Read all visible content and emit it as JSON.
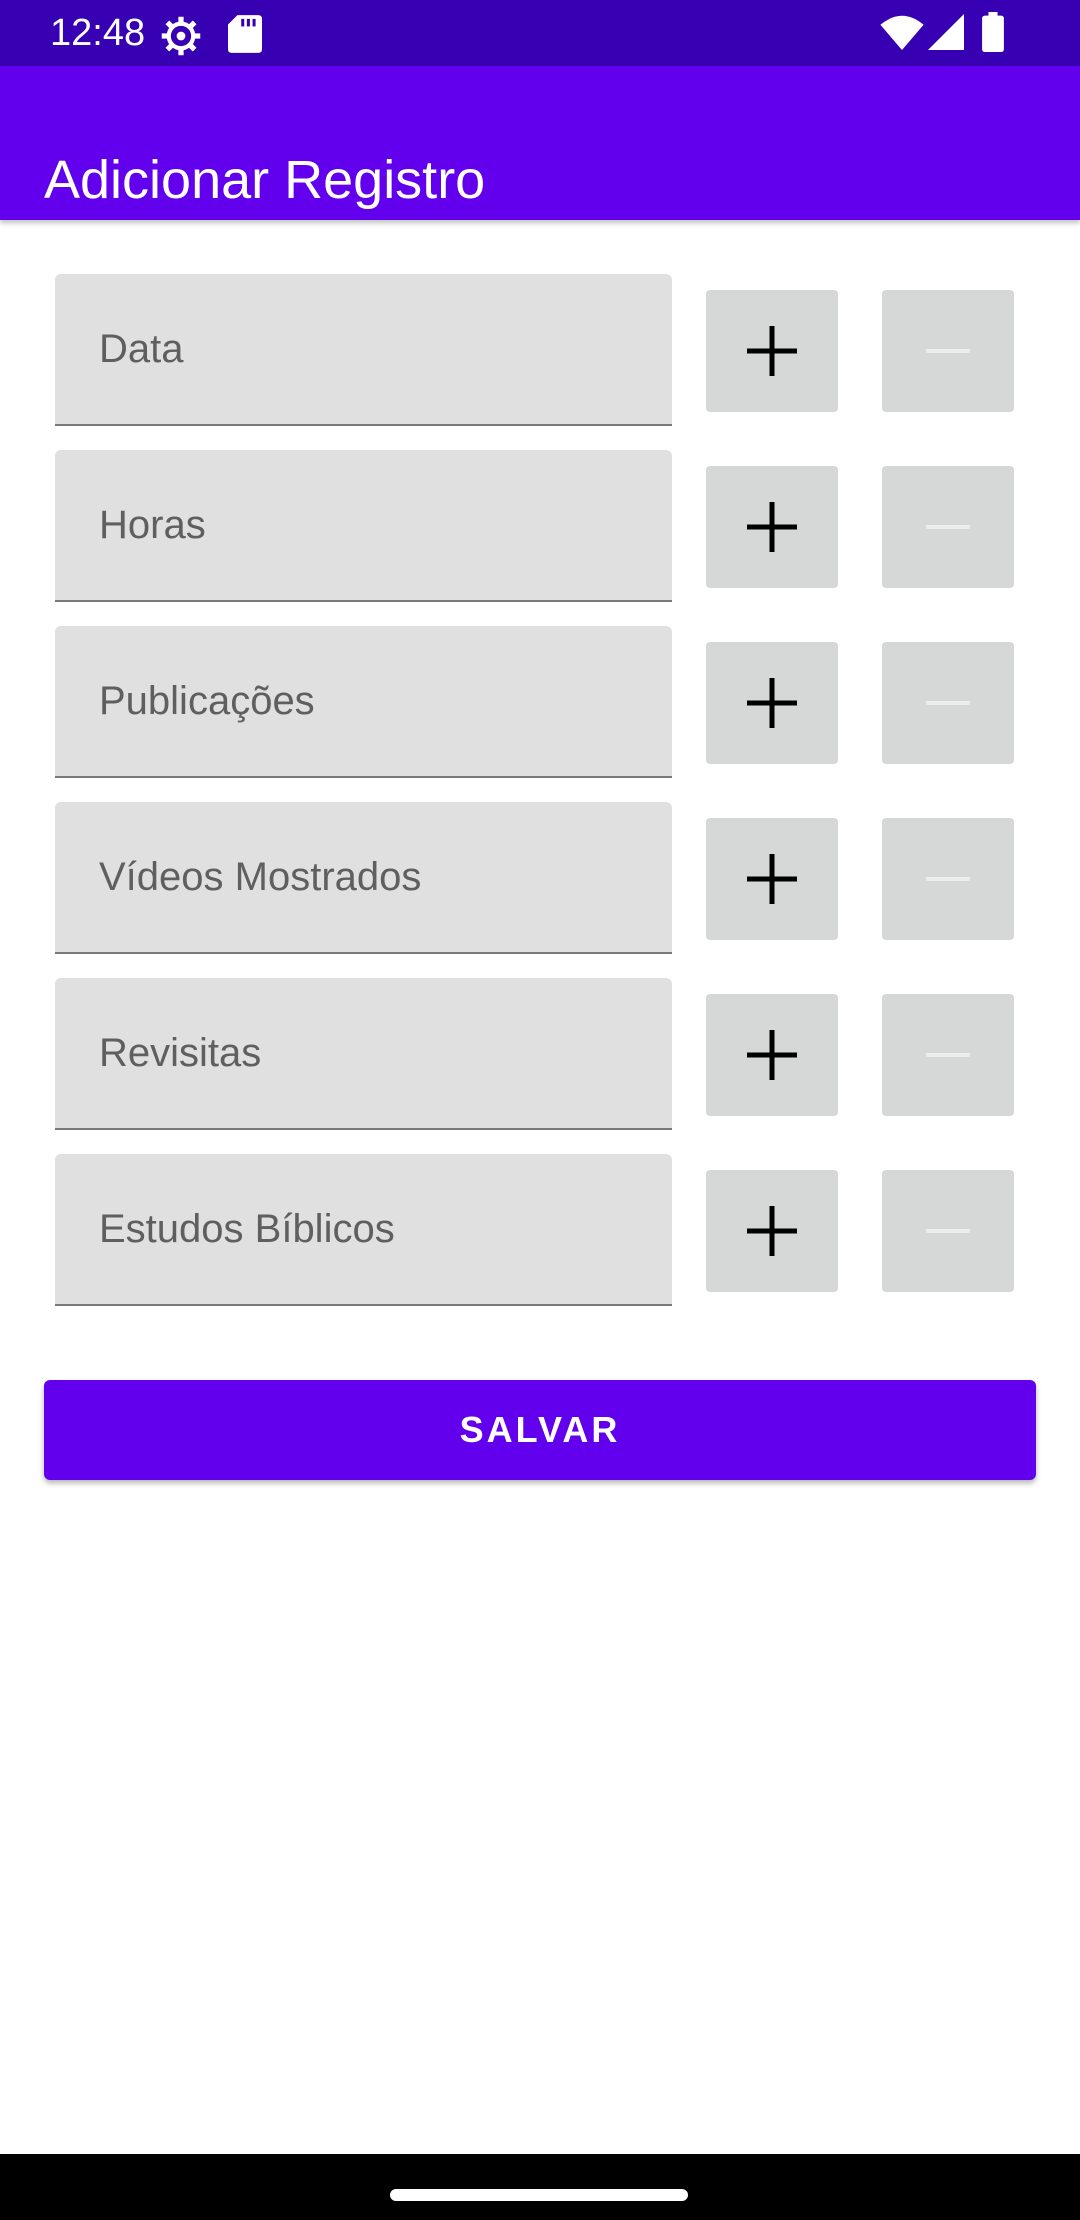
{
  "status_bar": {
    "time": "12:48",
    "icons_left": [
      "settings-gear-icon",
      "sd-card-icon"
    ],
    "icons_right": [
      "wifi-icon",
      "signal-icon",
      "battery-icon"
    ]
  },
  "app_bar": {
    "title": "Adicionar Registro",
    "color": "#6200ee"
  },
  "fields": [
    {
      "placeholder": "Data",
      "value": ""
    },
    {
      "placeholder": "Horas",
      "value": ""
    },
    {
      "placeholder": "Publicações",
      "value": ""
    },
    {
      "placeholder": "Vídeos Mostrados",
      "value": ""
    },
    {
      "placeholder": "Revisitas",
      "value": ""
    },
    {
      "placeholder": "Estudos Bíblicos",
      "value": ""
    }
  ],
  "stepper": {
    "plus_icon": "plus-icon",
    "minus_icon": "minus-icon",
    "minus_enabled": false
  },
  "save_button": {
    "label": "SALVAR",
    "color": "#6200ee"
  },
  "colors": {
    "status_bar": "#3700b3",
    "field_bg": "#e0e0e0",
    "button_bg": "#d6d7d7"
  }
}
